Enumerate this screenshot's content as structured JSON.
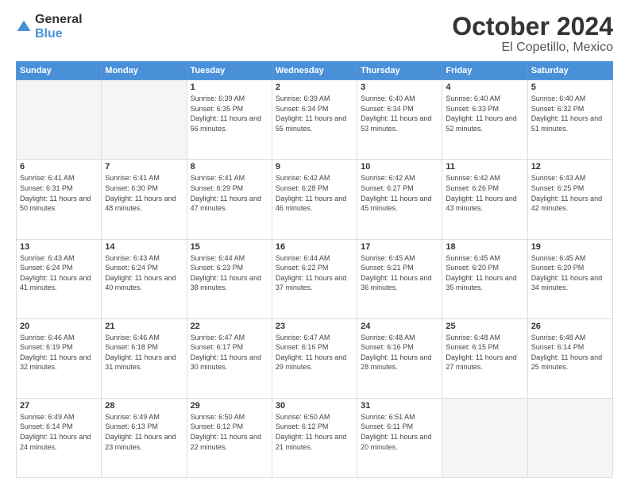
{
  "header": {
    "logo_general": "General",
    "logo_blue": "Blue",
    "month_title": "October 2024",
    "location": "El Copetillo, Mexico"
  },
  "weekdays": [
    "Sunday",
    "Monday",
    "Tuesday",
    "Wednesday",
    "Thursday",
    "Friday",
    "Saturday"
  ],
  "weeks": [
    [
      {
        "day": "",
        "empty": true
      },
      {
        "day": "",
        "empty": true
      },
      {
        "day": "1",
        "sunrise": "Sunrise: 6:39 AM",
        "sunset": "Sunset: 6:35 PM",
        "daylight": "Daylight: 11 hours and 56 minutes."
      },
      {
        "day": "2",
        "sunrise": "Sunrise: 6:39 AM",
        "sunset": "Sunset: 6:34 PM",
        "daylight": "Daylight: 11 hours and 55 minutes."
      },
      {
        "day": "3",
        "sunrise": "Sunrise: 6:40 AM",
        "sunset": "Sunset: 6:34 PM",
        "daylight": "Daylight: 11 hours and 53 minutes."
      },
      {
        "day": "4",
        "sunrise": "Sunrise: 6:40 AM",
        "sunset": "Sunset: 6:33 PM",
        "daylight": "Daylight: 11 hours and 52 minutes."
      },
      {
        "day": "5",
        "sunrise": "Sunrise: 6:40 AM",
        "sunset": "Sunset: 6:32 PM",
        "daylight": "Daylight: 11 hours and 51 minutes."
      }
    ],
    [
      {
        "day": "6",
        "sunrise": "Sunrise: 6:41 AM",
        "sunset": "Sunset: 6:31 PM",
        "daylight": "Daylight: 11 hours and 50 minutes."
      },
      {
        "day": "7",
        "sunrise": "Sunrise: 6:41 AM",
        "sunset": "Sunset: 6:30 PM",
        "daylight": "Daylight: 11 hours and 48 minutes."
      },
      {
        "day": "8",
        "sunrise": "Sunrise: 6:41 AM",
        "sunset": "Sunset: 6:29 PM",
        "daylight": "Daylight: 11 hours and 47 minutes."
      },
      {
        "day": "9",
        "sunrise": "Sunrise: 6:42 AM",
        "sunset": "Sunset: 6:28 PM",
        "daylight": "Daylight: 11 hours and 46 minutes."
      },
      {
        "day": "10",
        "sunrise": "Sunrise: 6:42 AM",
        "sunset": "Sunset: 6:27 PM",
        "daylight": "Daylight: 11 hours and 45 minutes."
      },
      {
        "day": "11",
        "sunrise": "Sunrise: 6:42 AM",
        "sunset": "Sunset: 6:26 PM",
        "daylight": "Daylight: 11 hours and 43 minutes."
      },
      {
        "day": "12",
        "sunrise": "Sunrise: 6:43 AM",
        "sunset": "Sunset: 6:25 PM",
        "daylight": "Daylight: 11 hours and 42 minutes."
      }
    ],
    [
      {
        "day": "13",
        "sunrise": "Sunrise: 6:43 AM",
        "sunset": "Sunset: 6:24 PM",
        "daylight": "Daylight: 11 hours and 41 minutes."
      },
      {
        "day": "14",
        "sunrise": "Sunrise: 6:43 AM",
        "sunset": "Sunset: 6:24 PM",
        "daylight": "Daylight: 11 hours and 40 minutes."
      },
      {
        "day": "15",
        "sunrise": "Sunrise: 6:44 AM",
        "sunset": "Sunset: 6:23 PM",
        "daylight": "Daylight: 11 hours and 38 minutes."
      },
      {
        "day": "16",
        "sunrise": "Sunrise: 6:44 AM",
        "sunset": "Sunset: 6:22 PM",
        "daylight": "Daylight: 11 hours and 37 minutes."
      },
      {
        "day": "17",
        "sunrise": "Sunrise: 6:45 AM",
        "sunset": "Sunset: 6:21 PM",
        "daylight": "Daylight: 11 hours and 36 minutes."
      },
      {
        "day": "18",
        "sunrise": "Sunrise: 6:45 AM",
        "sunset": "Sunset: 6:20 PM",
        "daylight": "Daylight: 11 hours and 35 minutes."
      },
      {
        "day": "19",
        "sunrise": "Sunrise: 6:45 AM",
        "sunset": "Sunset: 6:20 PM",
        "daylight": "Daylight: 11 hours and 34 minutes."
      }
    ],
    [
      {
        "day": "20",
        "sunrise": "Sunrise: 6:46 AM",
        "sunset": "Sunset: 6:19 PM",
        "daylight": "Daylight: 11 hours and 32 minutes."
      },
      {
        "day": "21",
        "sunrise": "Sunrise: 6:46 AM",
        "sunset": "Sunset: 6:18 PM",
        "daylight": "Daylight: 11 hours and 31 minutes."
      },
      {
        "day": "22",
        "sunrise": "Sunrise: 6:47 AM",
        "sunset": "Sunset: 6:17 PM",
        "daylight": "Daylight: 11 hours and 30 minutes."
      },
      {
        "day": "23",
        "sunrise": "Sunrise: 6:47 AM",
        "sunset": "Sunset: 6:16 PM",
        "daylight": "Daylight: 11 hours and 29 minutes."
      },
      {
        "day": "24",
        "sunrise": "Sunrise: 6:48 AM",
        "sunset": "Sunset: 6:16 PM",
        "daylight": "Daylight: 11 hours and 28 minutes."
      },
      {
        "day": "25",
        "sunrise": "Sunrise: 6:48 AM",
        "sunset": "Sunset: 6:15 PM",
        "daylight": "Daylight: 11 hours and 27 minutes."
      },
      {
        "day": "26",
        "sunrise": "Sunrise: 6:48 AM",
        "sunset": "Sunset: 6:14 PM",
        "daylight": "Daylight: 11 hours and 25 minutes."
      }
    ],
    [
      {
        "day": "27",
        "sunrise": "Sunrise: 6:49 AM",
        "sunset": "Sunset: 6:14 PM",
        "daylight": "Daylight: 11 hours and 24 minutes."
      },
      {
        "day": "28",
        "sunrise": "Sunrise: 6:49 AM",
        "sunset": "Sunset: 6:13 PM",
        "daylight": "Daylight: 11 hours and 23 minutes."
      },
      {
        "day": "29",
        "sunrise": "Sunrise: 6:50 AM",
        "sunset": "Sunset: 6:12 PM",
        "daylight": "Daylight: 11 hours and 22 minutes."
      },
      {
        "day": "30",
        "sunrise": "Sunrise: 6:50 AM",
        "sunset": "Sunset: 6:12 PM",
        "daylight": "Daylight: 11 hours and 21 minutes."
      },
      {
        "day": "31",
        "sunrise": "Sunrise: 6:51 AM",
        "sunset": "Sunset: 6:11 PM",
        "daylight": "Daylight: 11 hours and 20 minutes."
      },
      {
        "day": "",
        "empty": true
      },
      {
        "day": "",
        "empty": true
      }
    ]
  ]
}
